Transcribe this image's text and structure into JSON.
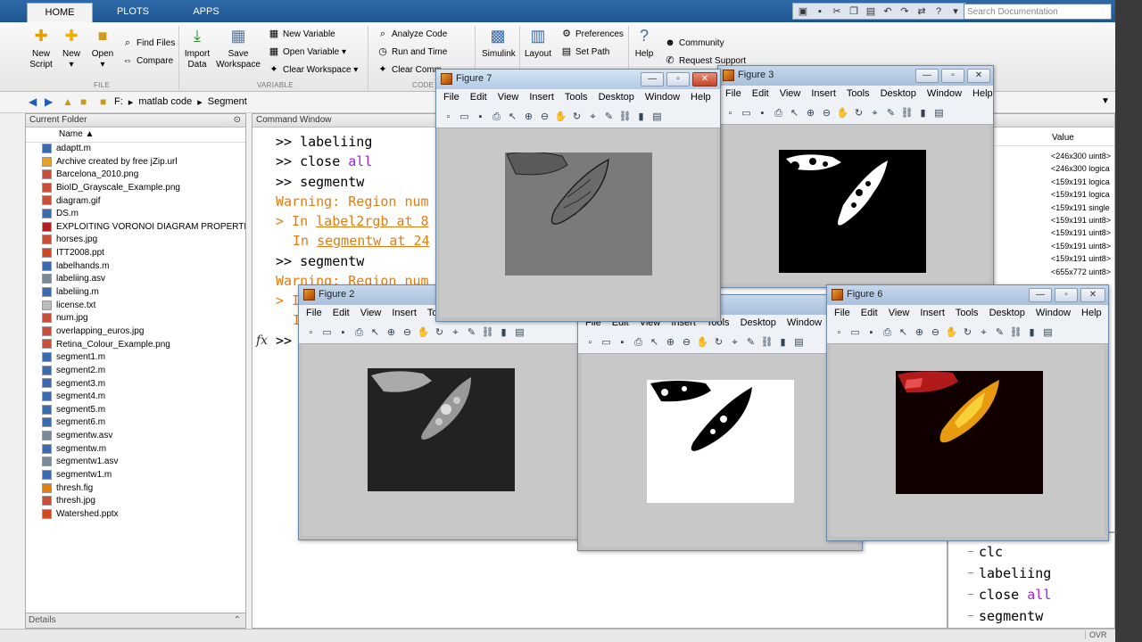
{
  "tabs": [
    {
      "label": "HOME",
      "active": true
    },
    {
      "label": "PLOTS",
      "active": false
    },
    {
      "label": "APPS",
      "active": false
    }
  ],
  "search": {
    "placeholder": "Search Documentation"
  },
  "ribbon": {
    "file": {
      "new_script": [
        "New",
        "Script"
      ],
      "new": [
        "New",
        ""
      ],
      "open": [
        "Open",
        ""
      ],
      "find_files": "Find Files",
      "compare": "Compare",
      "section": "FILE"
    },
    "variable": {
      "import": [
        "Import",
        "Data"
      ],
      "save": [
        "Save",
        "Workspace"
      ],
      "new_variable": "New Variable",
      "open_variable": "Open Variable ▾",
      "clear_workspace": "Clear Workspace ▾",
      "section": "VARIABLE"
    },
    "code": {
      "analyze": "Analyze Code",
      "run_time": "Run and Time",
      "clear_commands": "Clear Comm",
      "section": "CODE"
    },
    "simulink": "Simulink",
    "environment": {
      "layout": "Layout",
      "preferences": "Preferences",
      "set_path": "Set Path"
    },
    "resources": {
      "help": "Help",
      "community": "Community",
      "request_support": "Request Support"
    }
  },
  "address": {
    "crumbs": [
      "F:",
      "▸",
      "matlab code",
      "▸",
      "Segment"
    ]
  },
  "current_folder": {
    "title": "Current Folder",
    "column": "Name ▲",
    "files": [
      {
        "name": "adaptt.m",
        "type": "m"
      },
      {
        "name": "Archive created by free jZip.url",
        "type": "url"
      },
      {
        "name": "Barcelona_2010.png",
        "type": "img"
      },
      {
        "name": "BioID_Grayscale_Example.png",
        "type": "img"
      },
      {
        "name": "diagram.gif",
        "type": "img"
      },
      {
        "name": "DS.m",
        "type": "m"
      },
      {
        "name": "EXPLOITING VORONOI DIAGRAM PROPERTI...",
        "type": "pdf"
      },
      {
        "name": "horses.jpg",
        "type": "img"
      },
      {
        "name": "ITT2008.ppt",
        "type": "ppt"
      },
      {
        "name": "labelhands.m",
        "type": "m"
      },
      {
        "name": "labeliing.asv",
        "type": "asv"
      },
      {
        "name": "labeliing.m",
        "type": "m"
      },
      {
        "name": "license.txt",
        "type": "txt"
      },
      {
        "name": "num.jpg",
        "type": "img"
      },
      {
        "name": "overlapping_euros.jpg",
        "type": "img"
      },
      {
        "name": "Retina_Colour_Example.png",
        "type": "img"
      },
      {
        "name": "segment1.m",
        "type": "m"
      },
      {
        "name": "segment2.m",
        "type": "m"
      },
      {
        "name": "segment3.m",
        "type": "m"
      },
      {
        "name": "segment4.m",
        "type": "m"
      },
      {
        "name": "segment5.m",
        "type": "m"
      },
      {
        "name": "segment6.m",
        "type": "m"
      },
      {
        "name": "segmentw.asv",
        "type": "asv"
      },
      {
        "name": "segmentw.m",
        "type": "m"
      },
      {
        "name": "segmentw1.asv",
        "type": "asv"
      },
      {
        "name": "segmentw1.m",
        "type": "m"
      },
      {
        "name": "thresh.fig",
        "type": "fig"
      },
      {
        "name": "thresh.jpg",
        "type": "img"
      },
      {
        "name": "Watershed.pptx",
        "type": "ppt"
      }
    ]
  },
  "details": "Details",
  "command_window": {
    "title": "Command Window",
    "prompt": ">>",
    "cmd1": "labeliing",
    "cmd2a": "close",
    "cmd2b": "all",
    "cmd3": "segmentw",
    "warn1": "Warning: Region num",
    "warn2a": "> In",
    "warn2b": "label2rgb at 8",
    "warn3a": "In",
    "warn3b": "segmentw at 24",
    "cmd4": "segmentw",
    "warn4": "Warning: Region num",
    "partial1": "> I",
    "partial2": "I",
    "fx": "fx"
  },
  "workspace": {
    "value_header": "Value",
    "values": [
      "<246x300 uint8>",
      "<246x300 logica",
      "<159x191 logica",
      "<159x191 logica",
      "<159x191 single",
      "<159x191 uint8>",
      "<159x191 uint8>",
      "<159x191 uint8>",
      "<159x191 uint8>",
      "<655x772 uint8>"
    ]
  },
  "history": {
    "lines": [
      {
        "a": "clc",
        "b": ""
      },
      {
        "a": "labeliing",
        "b": ""
      },
      {
        "a": "close",
        "b": "all"
      },
      {
        "a": "segmentw",
        "b": ""
      }
    ]
  },
  "status": {
    "ovr": "OVR"
  },
  "figure_menu": [
    "File",
    "Edit",
    "View",
    "Insert",
    "Tools",
    "Desktop",
    "Window",
    "Help"
  ],
  "figures": {
    "fig7": "Figure 7",
    "fig3": "Figure 3",
    "fig2": "Figure 2",
    "fig6": "Figure 6"
  },
  "colors": {
    "ribbon_tabstrip": "#1d5592",
    "prompt_keyword": "#a020f0",
    "warning": "#e37c10"
  }
}
